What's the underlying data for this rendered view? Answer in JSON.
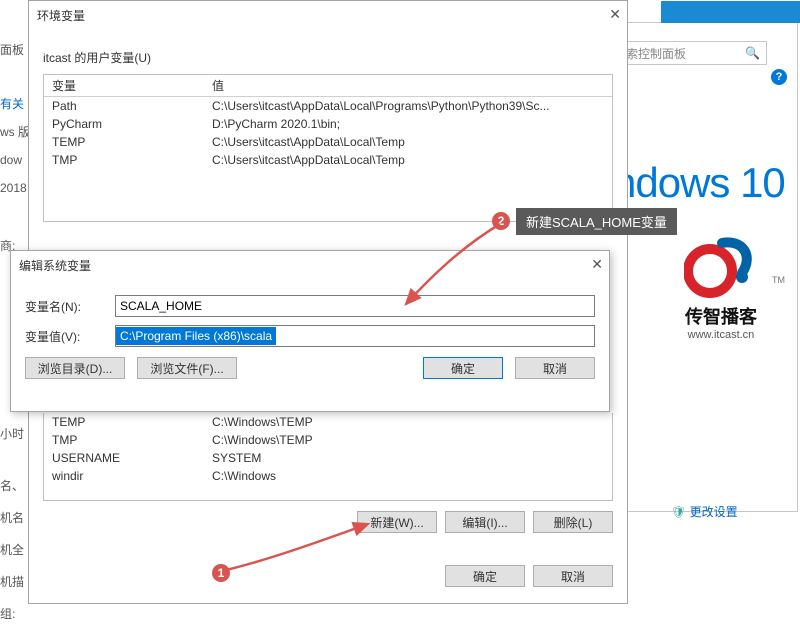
{
  "bgWindow": {
    "searchPlaceholder": "搜索控制面板",
    "win10": "ndows 10",
    "logoBrand": "传智播客",
    "logoDomain": "www.itcast.cn",
    "changeSettings": "更改设置",
    "leftFragments": [
      "面板",
      "有关",
      "ws 版",
      "dow",
      "2018",
      "商:",
      "小时",
      "名、",
      "机名",
      "机全",
      "机描",
      "组:"
    ]
  },
  "envDialog": {
    "title": "环境变量",
    "userGroup": "itcast 的用户变量(U)",
    "headers": {
      "var": "变量",
      "val": "值"
    },
    "userVars": [
      {
        "name": "Path",
        "value": "C:\\Users\\itcast\\AppData\\Local\\Programs\\Python\\Python39\\Sc..."
      },
      {
        "name": "PyCharm",
        "value": "D:\\PyCharm 2020.1\\bin;"
      },
      {
        "name": "TEMP",
        "value": "C:\\Users\\itcast\\AppData\\Local\\Temp"
      },
      {
        "name": "TMP",
        "value": "C:\\Users\\itcast\\AppData\\Local\\Temp"
      }
    ],
    "sysVarsVisible": [
      {
        "name": "TEMP",
        "value": "C:\\Windows\\TEMP"
      },
      {
        "name": "TMP",
        "value": "C:\\Windows\\TEMP"
      },
      {
        "name": "USERNAME",
        "value": "SYSTEM"
      },
      {
        "name": "windir",
        "value": "C:\\Windows"
      }
    ],
    "buttons": {
      "new": "新建(W)...",
      "edit": "编辑(I)...",
      "delete": "删除(L)",
      "ok": "确定",
      "cancel": "取消"
    }
  },
  "editDialog": {
    "title": "编辑系统变量",
    "nameLabel": "变量名(N):",
    "valueLabel": "变量值(V):",
    "nameValue": "SCALA_HOME",
    "valueValue": "C:\\Program Files (x86)\\scala",
    "browseDir": "浏览目录(D)...",
    "browseFile": "浏览文件(F)...",
    "ok": "确定",
    "cancel": "取消"
  },
  "annotations": {
    "badge1": "1",
    "badge2": "2",
    "tip2": "新建SCALA_HOME变量"
  }
}
